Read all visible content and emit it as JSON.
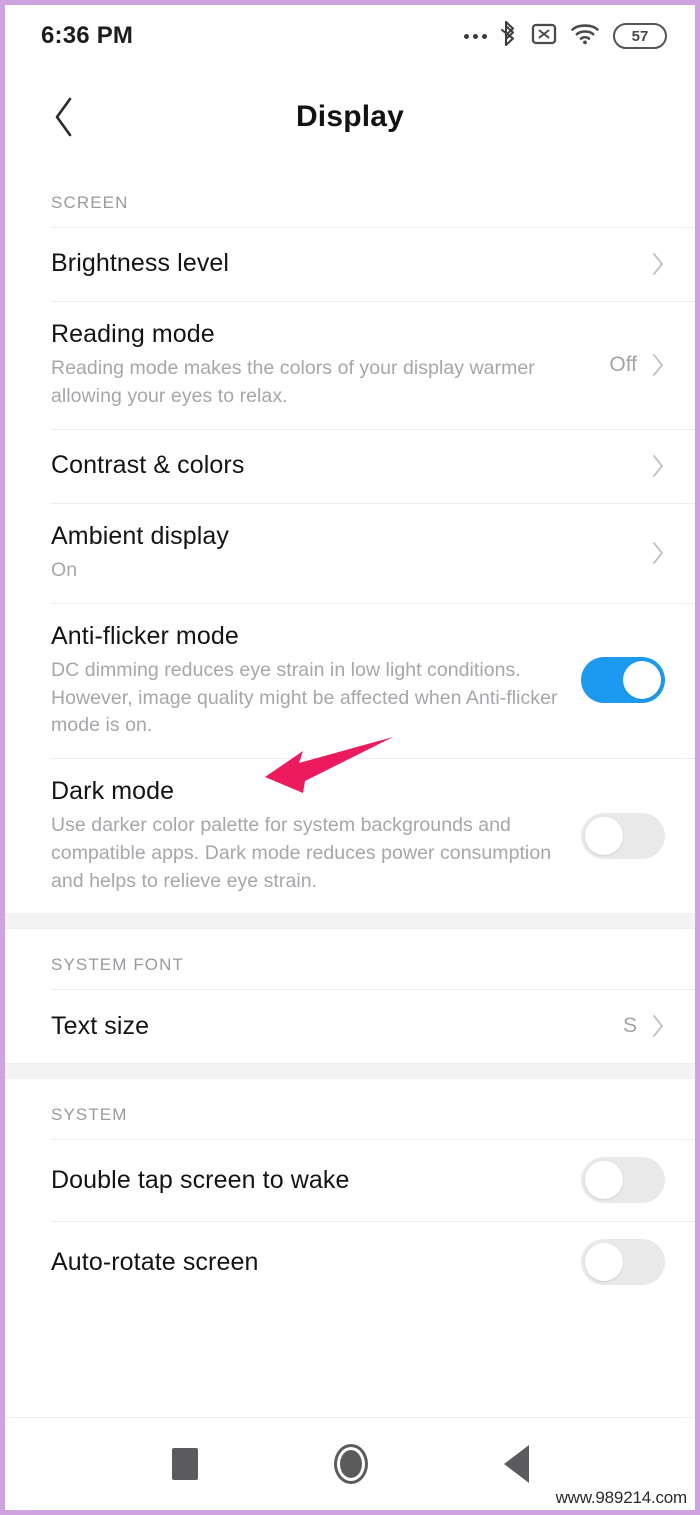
{
  "statusbar": {
    "time": "6:36 PM",
    "icons": [
      "more-dots-icon",
      "bluetooth-icon",
      "no-sim-icon",
      "wifi-icon",
      "battery-icon"
    ],
    "battery_level": "57"
  },
  "titlebar": {
    "back_icon": "back-chevron-icon",
    "title": "Display"
  },
  "sections": [
    {
      "header": "SCREEN",
      "rows": [
        {
          "title": "Brightness level",
          "subtitle": "",
          "value": "",
          "control": "chevron"
        },
        {
          "title": "Reading mode",
          "subtitle": "Reading mode makes the colors of your display warmer allowing your eyes to relax.",
          "value": "Off",
          "control": "chevron"
        },
        {
          "title": "Contrast & colors",
          "subtitle": "",
          "value": "",
          "control": "chevron"
        },
        {
          "title": "Ambient display",
          "subtitle": "On",
          "value": "",
          "control": "chevron"
        },
        {
          "title": "Anti-flicker mode",
          "subtitle": "DC dimming reduces eye strain in low light conditions. However, image quality might be affected when Anti-flicker mode is on.",
          "value": "",
          "control": "switch",
          "switch_state": "on"
        },
        {
          "title": "Dark mode",
          "subtitle": "Use darker color palette for system backgrounds and compatible apps. Dark mode reduces power consumption and helps to relieve eye strain.",
          "value": "",
          "control": "switch",
          "switch_state": "off"
        }
      ]
    },
    {
      "header": "SYSTEM FONT",
      "rows": [
        {
          "title": "Text size",
          "subtitle": "",
          "value": "S",
          "control": "chevron"
        }
      ]
    },
    {
      "header": "SYSTEM",
      "rows": [
        {
          "title": "Double tap screen to wake",
          "subtitle": "",
          "value": "",
          "control": "switch",
          "switch_state": "off"
        },
        {
          "title": "Auto-rotate screen",
          "subtitle": "",
          "value": "",
          "control": "switch",
          "switch_state": "off"
        }
      ]
    }
  ],
  "annotation": {
    "type": "arrow",
    "points_to": "Ambient display",
    "color": "#ED1B5E"
  },
  "navbar": {
    "recents_label": "recents-square-icon",
    "home_label": "home-circle-icon",
    "back_label": "back-triangle-icon"
  },
  "watermark": "www.989214.com",
  "colors": {
    "accent_toggle_on": "#1c9af0",
    "toggle_off": "#e9e9ea",
    "title_text": "#141414",
    "secondary_text": "#a6a6ab",
    "border": "#cfa3e0"
  }
}
